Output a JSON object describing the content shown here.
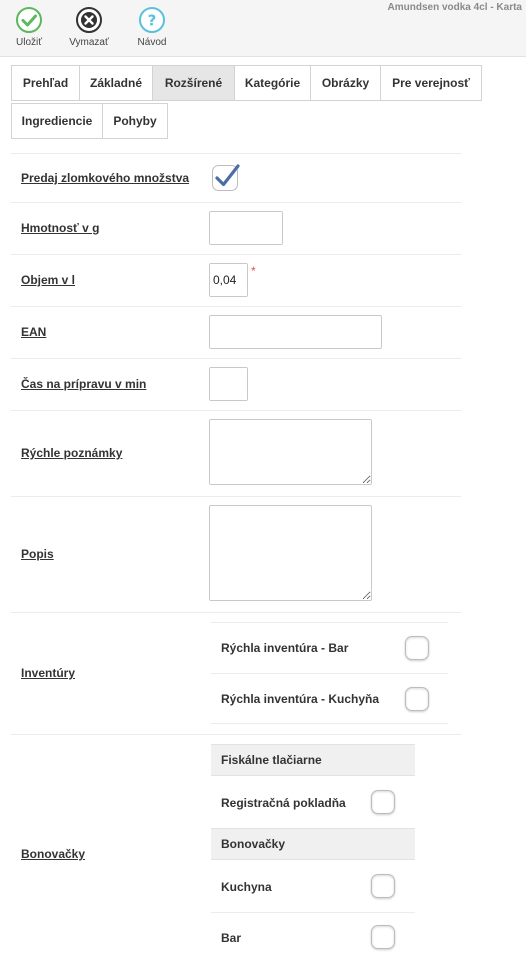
{
  "window_title": "Amundsen vodka 4cl - Karta",
  "toolbar": {
    "save_label": "Uložiť",
    "delete_label": "Vymazať",
    "help_label": "Návod"
  },
  "tabs": [
    {
      "label": "Prehľad"
    },
    {
      "label": "Základné"
    },
    {
      "label": "Rozšírené",
      "active": true
    },
    {
      "label": "Kategórie"
    },
    {
      "label": "Obrázky"
    },
    {
      "label": "Pre verejnosť"
    },
    {
      "label": "Ingrediencie"
    },
    {
      "label": "Pohyby"
    }
  ],
  "form": {
    "fractional_sale": {
      "label": "Predaj zlomkového množstva",
      "checked": true
    },
    "weight": {
      "label": "Hmotnosť v g",
      "value": ""
    },
    "volume": {
      "label": "Objem v l",
      "value": "0,04",
      "required_mark": "*"
    },
    "ean": {
      "label": "EAN",
      "value": ""
    },
    "prep_time": {
      "label": "Čas na prípravu v min",
      "value": ""
    },
    "quick_notes": {
      "label": "Rýchle poznámky",
      "value": ""
    },
    "description": {
      "label": "Popis",
      "value": ""
    },
    "inventories": {
      "label": "Inventúry",
      "items": [
        {
          "label": "Rýchla inventúra - Bar",
          "checked": false
        },
        {
          "label": "Rýchla inventúra - Kuchyňa",
          "checked": false
        }
      ]
    },
    "printers": {
      "label": "Bonovačky",
      "fiscal_header": "Fiskálne tlačiarne",
      "fiscal_items": [
        {
          "label": "Registračná pokladňa",
          "checked": false
        }
      ],
      "bon_header": "Bonovačky",
      "bon_items": [
        {
          "label": "Kuchyna",
          "checked": false
        },
        {
          "label": "Bar",
          "checked": false
        }
      ]
    }
  },
  "colors": {
    "save_green": "#5cb85c",
    "delete_dark": "#333333",
    "help_blue": "#5bc0de",
    "check_blue": "#4a6fa5",
    "required_red": "#d9534f"
  }
}
